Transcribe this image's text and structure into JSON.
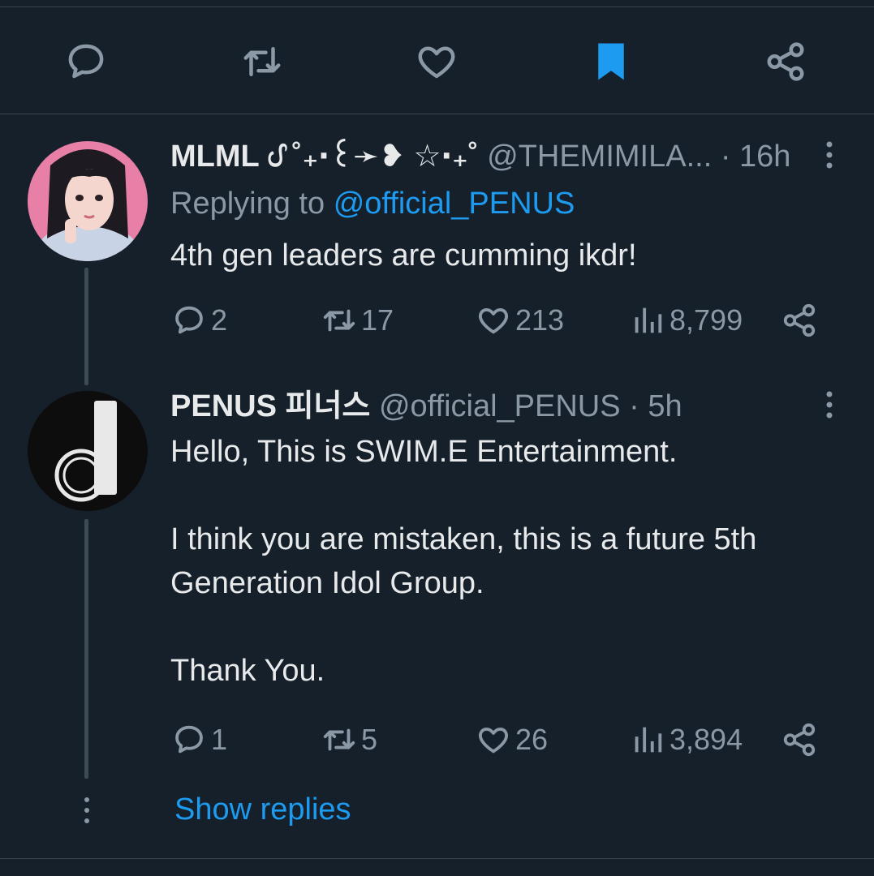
{
  "action_bar": {
    "icons": [
      "reply-icon",
      "retweet-icon",
      "like-icon",
      "bookmark-icon",
      "share-icon"
    ],
    "bookmark_color": "#1d9bf0"
  },
  "tweets": [
    {
      "display_name": "MLML ᦔ ˚₊‧꒰➛❥ ☆‧₊˚",
      "handle": "@THEMIMILA...",
      "time": "· 16h",
      "replying_to_label": "Replying to",
      "replying_to_handle": "@official_PENUS",
      "text": "4th gen leaders are cumming ikdr!",
      "stats": {
        "replies": "2",
        "retweets": "17",
        "likes": "213",
        "views": "8,799"
      }
    },
    {
      "display_name": "PENUS 피너스",
      "handle": "@official_PENUS",
      "time": "· 5h",
      "text_paragraphs": [
        "Hello, This is SWIM.E Entertainment.",
        "I think you are mistaken, this is a future 5th",
        "Generation Idol Group.",
        "Thank You."
      ],
      "stats": {
        "replies": "1",
        "retweets": "5",
        "likes": "26",
        "views": "3,894"
      }
    }
  ],
  "show_replies_label": "Show replies",
  "colors": {
    "background": "#15202b",
    "accent": "#1d9bf0",
    "muted": "#8b98a5",
    "text": "#e7e9ea"
  }
}
